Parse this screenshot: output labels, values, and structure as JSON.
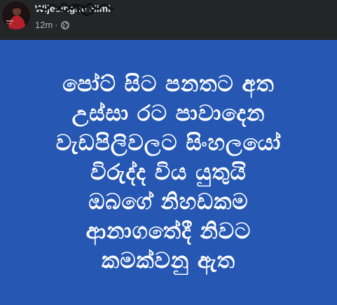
{
  "post": {
    "author_name": "Wijesinghe Himi",
    "timestamp": "12m",
    "separator": "·",
    "privacy_icon": "globe-icon",
    "avatar_icon": "profile-photo",
    "background_color": "#2557b3",
    "text_lines": [
      "පෝට් සිට පනතට අත",
      "උස්සා රට පාවාදෙන",
      "වැඩපිලිවලට සිංහලයෝ",
      "විරුද්ද විය යුතුයි",
      "ඔබගේ නිහඩකම",
      "ආනාගතේදී නිවට",
      "කමක්වනු ඇත"
    ]
  }
}
